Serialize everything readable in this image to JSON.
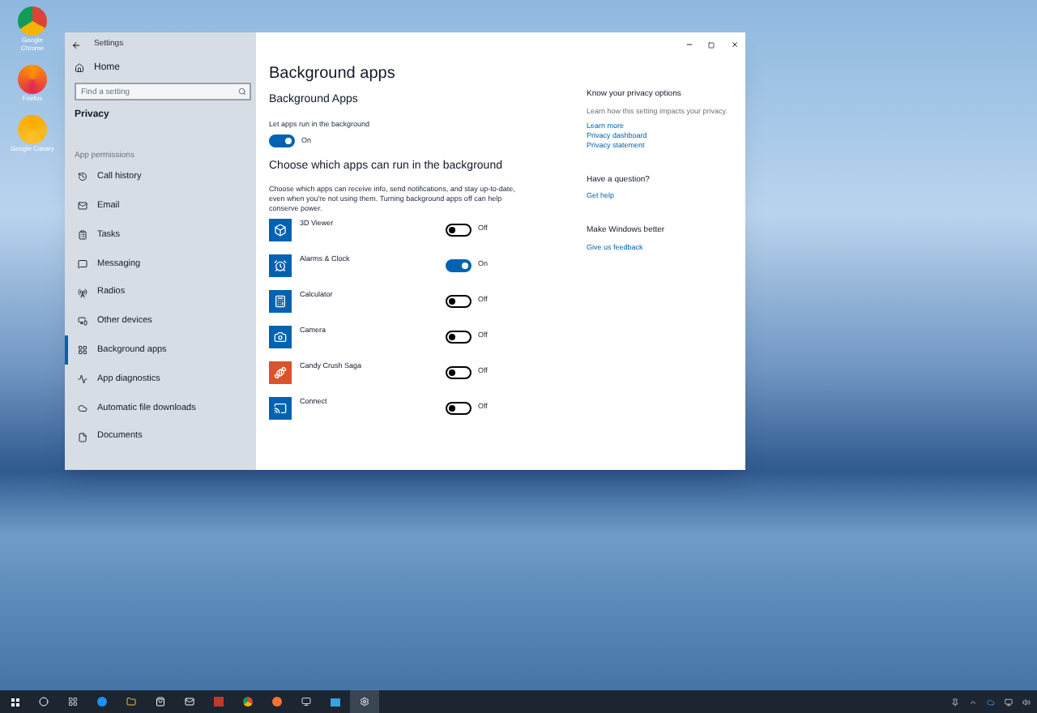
{
  "desktop_icons": [
    {
      "label": "Google Chrome",
      "kind": "chrome"
    },
    {
      "label": "Firefox",
      "kind": "firefox"
    },
    {
      "label": "Google Canary",
      "kind": "canary"
    }
  ],
  "window": {
    "title": "Settings"
  },
  "sidebar": {
    "home": "Home",
    "search": {
      "placeholder": "Find a setting"
    },
    "section": "Privacy",
    "group": "App permissions",
    "items": [
      {
        "label": "Call history",
        "kind": "history",
        "selected": false
      },
      {
        "label": "Email",
        "kind": "mail",
        "selected": false
      },
      {
        "label": "Tasks",
        "kind": "tasks",
        "selected": false
      },
      {
        "label": "Messaging",
        "kind": "message",
        "selected": false
      },
      {
        "label": "Radios",
        "kind": "radio",
        "selected": false
      },
      {
        "label": "Other devices",
        "kind": "devices",
        "selected": false
      },
      {
        "label": "Background apps",
        "kind": "apps",
        "selected": true
      },
      {
        "label": "App diagnostics",
        "kind": "diagnostics",
        "selected": false
      },
      {
        "label": "Automatic file downloads",
        "kind": "cloud",
        "selected": false
      },
      {
        "label": "Documents",
        "kind": "document",
        "selected": false
      }
    ]
  },
  "main": {
    "title": "Background apps",
    "section": "Background Apps",
    "setting_label": "Let apps run in the background",
    "master_toggle": {
      "on": true,
      "state_text": "On"
    },
    "subheading": "Choose which apps can run in the background",
    "description": "Choose which apps can receive info, send notifications, and stay up-to-date, even when you're not using them. Turning background apps off can help conserve power.",
    "apps": [
      {
        "name": "3D Viewer",
        "kind": "cube",
        "on": false,
        "state_text": "Off"
      },
      {
        "name": "Alarms & Clock",
        "kind": "alarm",
        "on": true,
        "state_text": "On"
      },
      {
        "name": "Calculator",
        "kind": "calculator",
        "on": false,
        "state_text": "Off"
      },
      {
        "name": "Camera",
        "kind": "camera",
        "on": false,
        "state_text": "Off"
      },
      {
        "name": "Candy Crush Saga",
        "kind": "candy",
        "on": false,
        "state_text": "Off"
      },
      {
        "name": "Connect",
        "kind": "connect",
        "on": false,
        "state_text": "Off"
      }
    ]
  },
  "aside": [
    {
      "heading": "Know your privacy options",
      "text": "Learn how this setting impacts your privacy.",
      "links": [
        "Learn more",
        "Privacy dashboard",
        "Privacy statement"
      ]
    },
    {
      "heading": "Have a question?",
      "links": [
        "Get help"
      ]
    },
    {
      "heading": "Make Windows better",
      "links": [
        "Give us feedback"
      ]
    }
  ]
}
